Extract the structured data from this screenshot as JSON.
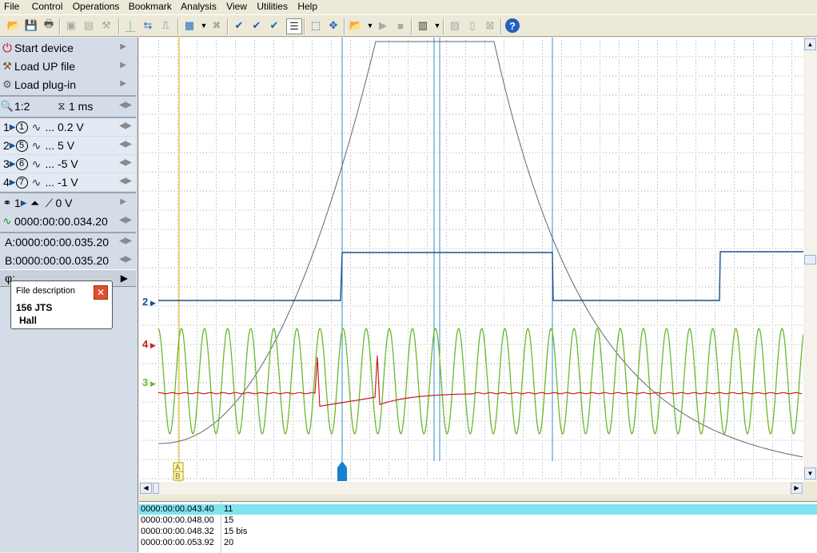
{
  "menu": [
    "File",
    "Control",
    "Operations",
    "Bookmark",
    "Analysis",
    "View",
    "Utilities",
    "Help"
  ],
  "left": {
    "start_device": "Start device",
    "load_up": "Load UP file",
    "load_plugin": "Load plug-in",
    "zoom": "1:2",
    "timebase": "1 ms",
    "channels": [
      {
        "num": "1",
        "probe": "1",
        "value": "... 0.2 V"
      },
      {
        "num": "2",
        "probe": "5",
        "value": "... 5 V"
      },
      {
        "num": "3",
        "probe": "6",
        "value": "... -5 V"
      },
      {
        "num": "4",
        "probe": "7",
        "value": "... -1 V"
      }
    ],
    "trigger_ch": "1",
    "trigger_level": "0 V",
    "trigger_time": "0000:00:00.034.20",
    "cursor_a_label": "A:",
    "cursor_a": "0000:00:00.035.20",
    "cursor_b_label": "B:",
    "cursor_b": "0000:00:00.035.20",
    "phi": "φ:"
  },
  "file_desc": {
    "title": "File description",
    "line1": "156 JTS",
    "line2": "Hall"
  },
  "plot_labels": {
    "ch2": "2",
    "ch4": "4",
    "ch3": "3",
    "cursor_ab": "A B"
  },
  "bookmarks": [
    {
      "time": "0000:00:00.043.40",
      "label": "11"
    },
    {
      "time": "0000:00:00.048.00",
      "label": "15"
    },
    {
      "time": "0000:00:00.048.32",
      "label": "15 bis"
    },
    {
      "time": "0000:00:00.053.92",
      "label": "20"
    }
  ],
  "colors": {
    "ch2": "#1a5090",
    "ch3": "#6ab82e",
    "ch4": "#cc1c1c",
    "ch1": "#666666",
    "marker": "#2f8fc8",
    "cursor": "#d8b000"
  }
}
